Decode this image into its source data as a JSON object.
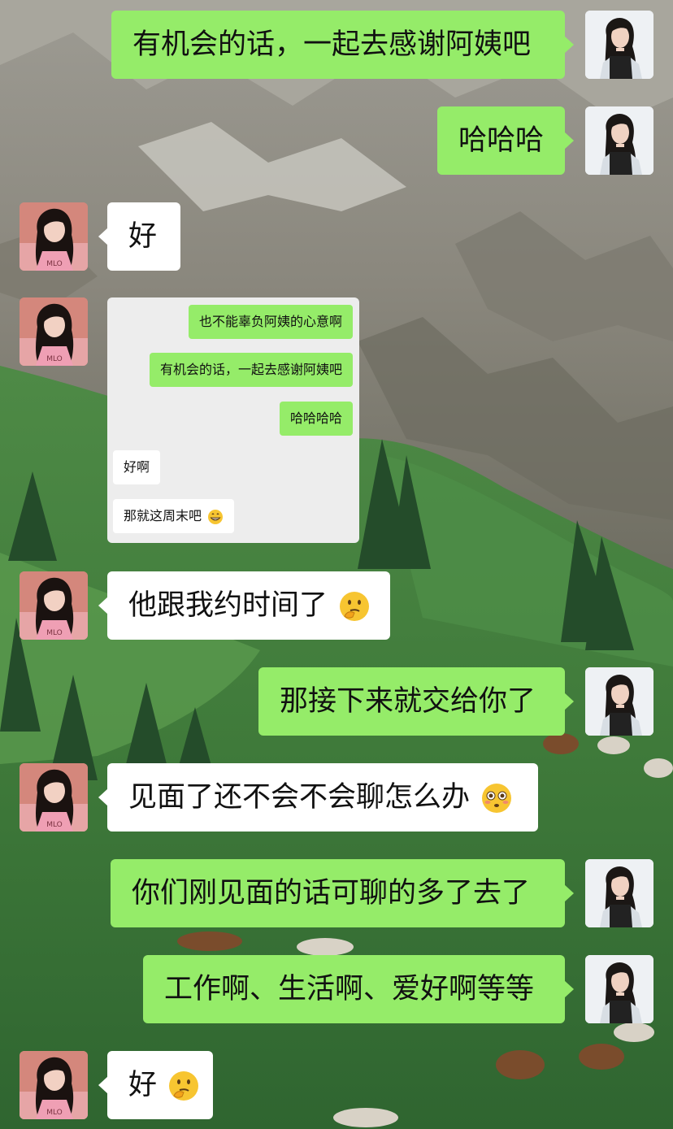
{
  "chat": {
    "messages": [
      {
        "side": "me",
        "text": "有机会的话，一起去感谢阿姨吧"
      },
      {
        "side": "me",
        "text": "哈哈哈"
      },
      {
        "side": "peer",
        "text": "好"
      },
      {
        "side": "peer",
        "type": "screenshot"
      },
      {
        "side": "peer",
        "text": "他跟我约时间了",
        "emoji": "thinking-face"
      },
      {
        "side": "me",
        "text": "那接下来就交给你了"
      },
      {
        "side": "peer",
        "text": "见面了还不会不会聊怎么办",
        "emoji": "flushed-face"
      },
      {
        "side": "me",
        "text": "你们刚见面的话可聊的多了去了"
      },
      {
        "side": "me",
        "text": "工作啊、生活啊、爱好啊等等"
      },
      {
        "side": "peer",
        "text": "好",
        "emoji": "thinking-face"
      }
    ]
  },
  "screenshot": {
    "messages": [
      {
        "side": "me",
        "text": "也不能辜负阿姨的心意啊"
      },
      {
        "side": "me",
        "text": "有机会的话，一起去感谢阿姨吧"
      },
      {
        "side": "me",
        "text": "哈哈哈哈"
      },
      {
        "side": "peer",
        "text": "好啊"
      },
      {
        "side": "peer",
        "text": "那就这周末吧",
        "emoji": "grinning-face"
      }
    ]
  },
  "avatars": {
    "me": "avatar-woman-dark-hair",
    "peer": "avatar-woman-pink-shirt"
  },
  "colors": {
    "bubble_me": "#95ec69",
    "bubble_peer": "#ffffff",
    "screenshot_bg": "#ededed"
  }
}
